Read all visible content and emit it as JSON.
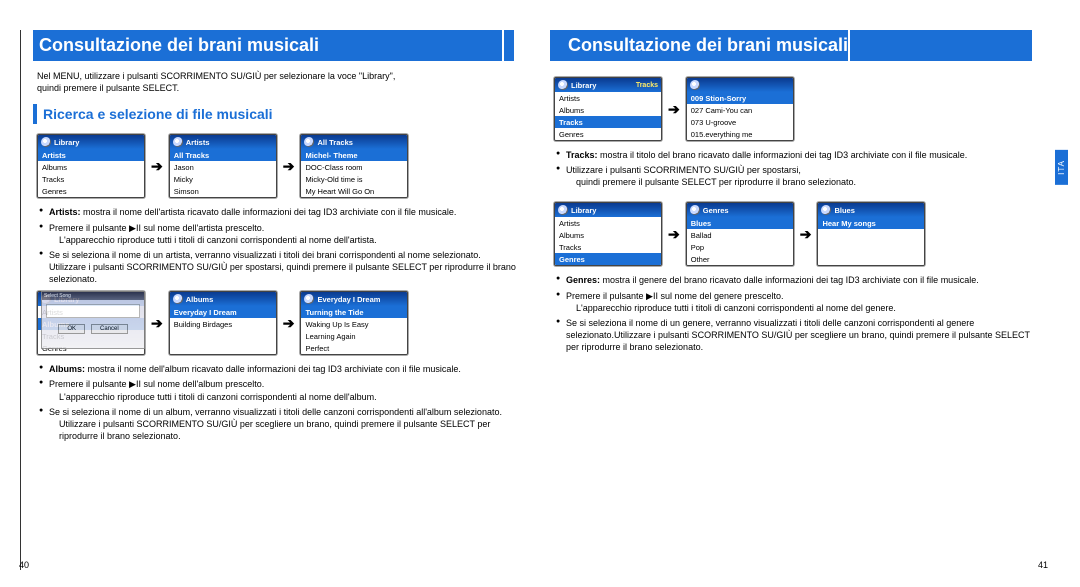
{
  "header_left": "Consultazione dei brani musicali",
  "header_right": "Consultazione dei brani musicali",
  "intro_l1": "Nel MENU, utilizzare i pulsanti SCORRIMENTO SU/GIÙ per selezionare la voce \"Library\",",
  "intro_l2": "quindi premere il pulsante SELECT.",
  "subhead": "Ricerca e selezione di file musicali",
  "ita_tab": "ITA",
  "page_left_num": "40",
  "page_right_num": "41",
  "row1": {
    "s1": {
      "title": "Library",
      "sel": "Artists",
      "rows": [
        "Albums",
        "Tracks",
        "Genres"
      ]
    },
    "s2": {
      "title": "Artists",
      "sel": "All Tracks",
      "rows": [
        "Jason",
        "Micky",
        "Simson"
      ]
    },
    "s3": {
      "title": "All Tracks",
      "sel": "Michel- Theme",
      "rows": [
        "DOC-Class room",
        "Micky-Old time is",
        "My Heart Will Go On"
      ]
    }
  },
  "artists_bul1": "Artists: mostra il nome dell'artista ricavato dalle informazioni dei tag ID3 archiviate con il file musicale.",
  "artists_bul2": "Premere il pulsante ▶II sul nome dell'artista prescelto.",
  "artists_bul2b": "L'apparecchio riproduce tutti i titoli di canzoni corrispondenti al nome dell'artista.",
  "artists_bul3": "Se si seleziona il nome di un artista, verranno visualizzati i titoli dei brani corrispondenti al nome selezionato. Utilizzare i pulsanti SCORRIMENTO SU/GIÙ per spostarsi, quindi premere il pulsante SELECT per riprodurre il brano selezionato.",
  "row2": {
    "s1": {
      "title": "Library",
      "sel": "Albums",
      "rows_pre": [
        "Artists"
      ],
      "rows": [
        "Tracks",
        "Genres"
      ]
    },
    "s2": {
      "title": "Albums",
      "sel": "Everyday I Dream",
      "rows": [
        "Building Birdages"
      ]
    },
    "s3": {
      "title": "Everyday I Dream",
      "sel": "Turning the Tide",
      "rows": [
        "Waking Up Is Easy",
        "Learning Again",
        "Perfect"
      ]
    }
  },
  "overlay_title": "Select Song",
  "overlay_ok": "OK",
  "overlay_cancel": "Cancel",
  "albums_bul1": "Albums: mostra il nome dell'album ricavato dalle informazioni dei tag ID3 archiviate con il file musicale.",
  "albums_bul2": "Premere il pulsante ▶II sul nome dell'album prescelto.",
  "albums_bul2b": "L'apparecchio riproduce tutti i titoli di canzoni corrispondenti al nome dell'album.",
  "albums_bul3": "Se si seleziona il nome di un album, verranno visualizzati i titoli delle canzoni corrispondenti all'album selezionato.",
  "albums_bul3b": "Utilizzare i pulsanti SCORRIMENTO SU/GIÙ per scegliere un brano, quindi premere il pulsante SELECT per riprodurre il brano selezionato.",
  "row3": {
    "s1": {
      "title": "Library",
      "rtitle": "Tracks",
      "rows_pre": [
        "Artists",
        "Albums"
      ],
      "sel": "Tracks",
      "rows": [
        "Genres"
      ]
    },
    "s2": {
      "title": "",
      "sel": "009 Stion-Sorry",
      "rows": [
        "027 Cami-You can",
        "073 U-groove",
        "015.everything me"
      ]
    }
  },
  "tracks_bul1": "Tracks: mostra il titolo del brano ricavato dalle informazioni dei tag ID3 archiviate con il file musicale.",
  "tracks_bul2": "Utilizzare i pulsanti SCORRIMENTO SU/GIÙ per spostarsi,",
  "tracks_bul2b": "quindi premere il pulsante SELECT per riprodurre il brano selezionato.",
  "row4": {
    "s1": {
      "title": "Library",
      "rows_pre": [
        "Artists",
        "Albums",
        "Tracks"
      ],
      "sel": "Genres"
    },
    "s2": {
      "title": "Genres",
      "sel": "Blues",
      "rows": [
        "Ballad",
        "Pop",
        "Other"
      ]
    },
    "s3": {
      "title": "Blues",
      "sel": "Hear My songs",
      "rows": []
    }
  },
  "genres_bul1": "Genres: mostra il genere del brano ricavato dalle informazioni dei tag ID3 archiviate con il file musicale.",
  "genres_bul2": "Premere il pulsante ▶II sul nome del genere prescelto.",
  "genres_bul2b": "L'apparecchio riproduce tutti i titoli di canzoni corrispondenti al nome del genere.",
  "genres_bul3": "Se si seleziona il nome di un genere, verranno visualizzati i titoli delle canzoni corrispondenti al genere selezionato.Utilizzare i pulsanti SCORRIMENTO SU/GIÙ per scegliere un brano, quindi premere il pulsante SELECT per riprodurre il brano selezionato."
}
